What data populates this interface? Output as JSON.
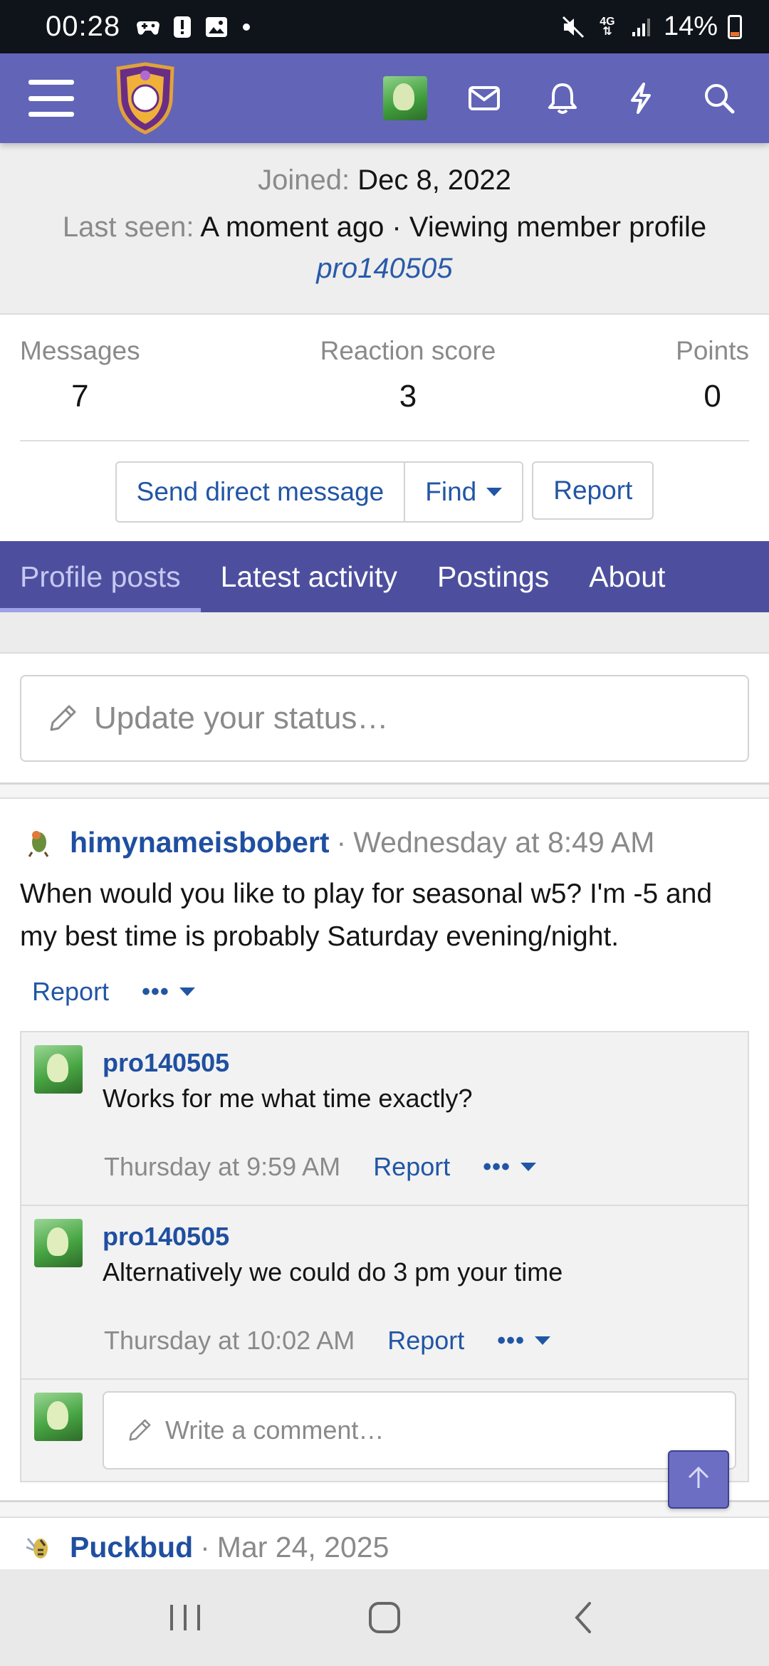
{
  "status_bar": {
    "time": "00:28",
    "battery": "14%",
    "network": "4G"
  },
  "profile": {
    "joined_label": "Joined:",
    "joined_value": "Dec 8, 2022",
    "last_seen_label": "Last seen:",
    "last_seen_value": "A moment ago · Viewing member profile",
    "viewing_user": "pro140505"
  },
  "stats": [
    {
      "label": "Messages",
      "value": "7"
    },
    {
      "label": "Reaction score",
      "value": "3"
    },
    {
      "label": "Points",
      "value": "0"
    }
  ],
  "actions": {
    "send_dm": "Send direct message",
    "find": "Find",
    "report": "Report"
  },
  "tabs": [
    {
      "label": "Profile posts",
      "active": true
    },
    {
      "label": "Latest activity"
    },
    {
      "label": "Postings"
    },
    {
      "label": "About"
    }
  ],
  "status_input": {
    "placeholder": "Update your status…"
  },
  "post": {
    "author": "himynameisbobert",
    "date": "Wednesday at 8:49 AM",
    "body": "When would you like to play for seasonal w5? I'm -5 and my best time is probably Saturday evening/night.",
    "report": "Report",
    "more": "•••"
  },
  "comments": [
    {
      "author": "pro140505",
      "text": "Works for me what time exactly?",
      "time": "Thursday at 9:59 AM",
      "report": "Report",
      "more": "•••"
    },
    {
      "author": "pro140505",
      "text": "Alternatively we could do 3 pm your time",
      "time": "Thursday at 10:02 AM",
      "report": "Report",
      "more": "•••"
    }
  ],
  "comment_input": {
    "placeholder": "Write a comment…"
  },
  "next_post": {
    "author": "Puckbud",
    "date": "Mar 24, 2025"
  },
  "colors": {
    "nav": "#6264b8",
    "tabs": "#4d4f9e",
    "link": "#2156a5",
    "status_bar": "#0f141b"
  }
}
